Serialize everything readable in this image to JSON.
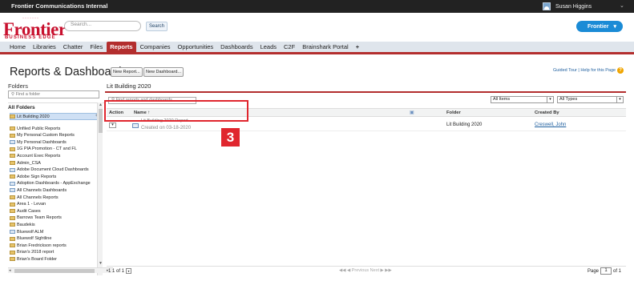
{
  "topbar": {
    "org": "Frontier Communications Internal",
    "user": "Susan Higgins"
  },
  "logo": {
    "dots": "·······",
    "brand": "Frontier",
    "sub": "BUSINESS EDGE"
  },
  "search": {
    "placeholder": "Search...",
    "button": "Search"
  },
  "app_menu": {
    "label": "Frontier"
  },
  "tabs": [
    {
      "label": "Home"
    },
    {
      "label": "Libraries"
    },
    {
      "label": "Chatter"
    },
    {
      "label": "Files"
    },
    {
      "label": "Reports",
      "active": true
    },
    {
      "label": "Companies"
    },
    {
      "label": "Opportunities"
    },
    {
      "label": "Dashboards"
    },
    {
      "label": "Leads"
    },
    {
      "label": "C2F"
    },
    {
      "label": "Brainshark Portal"
    },
    {
      "label": "+"
    }
  ],
  "page": {
    "title": "Reports & Dashboards",
    "new_report": "New Report...",
    "new_dashboard": "New Dashboard...",
    "guided_tour": "Guided Tour | Help for this Page"
  },
  "folders_panel": {
    "heading": "Folders",
    "find_placeholder": "Find a folder",
    "all_folders": "All Folders",
    "selected": "Lit Building 2020",
    "items": [
      {
        "label": "Unfiled Public Reports",
        "pub": false
      },
      {
        "label": "My Personal Custom Reports",
        "pub": false
      },
      {
        "label": "My Personal Dashboards",
        "pub": true
      },
      {
        "label": "1G PIA Promotion - CT and FL",
        "pub": false
      },
      {
        "label": "Account Exec Reports",
        "pub": false
      },
      {
        "label": "Admin_CSA",
        "pub": false
      },
      {
        "label": "Adobe Document Cloud Dashboards",
        "pub": true
      },
      {
        "label": "Adobe Sign Reports",
        "pub": false
      },
      {
        "label": "Adoption Dashboards - AppExchange",
        "pub": true
      },
      {
        "label": "All Channels Dashboards",
        "pub": true
      },
      {
        "label": "All Channels Reports",
        "pub": false
      },
      {
        "label": "Area 1 - Levan",
        "pub": false
      },
      {
        "label": "Audit Cases",
        "pub": false
      },
      {
        "label": "Barrows Team Reports",
        "pub": false
      },
      {
        "label": "Baudekis",
        "pub": false
      },
      {
        "label": "Bluewolf ALM",
        "pub": true
      },
      {
        "label": "Bluewolf Sightline",
        "pub": false
      },
      {
        "label": "Brian Fredrickson reports",
        "pub": false
      },
      {
        "label": "Brian's 2018 report",
        "pub": false
      },
      {
        "label": "Brian's Board Folder",
        "pub": false
      }
    ]
  },
  "reports_panel": {
    "title": "Lit Building 2020",
    "find_placeholder": "Find reports and dashboards",
    "filter_items": "All Items",
    "filter_types": "All Types",
    "columns": {
      "action": "Action",
      "name": "Name ↑",
      "folder": "Folder",
      "created_by": "Created By"
    },
    "rows": [
      {
        "name": "Lit Building 2020 Report",
        "created": "Created on 03-18-2020",
        "folder": "Lit Building 2020",
        "created_by": "Creswell, John"
      }
    ],
    "callout_number": "3"
  },
  "footer": {
    "count": "1 1 of 1",
    "nav": "◀◀ ◀ Previous  Next ▶ ▶▶",
    "page_label": "Page",
    "page_value": "1",
    "page_of": "of 1"
  },
  "colors": {
    "accent": "#b32e2e",
    "brand": "#c8102e",
    "callout": "#e0262e",
    "app_button": "#1a8bd6"
  }
}
